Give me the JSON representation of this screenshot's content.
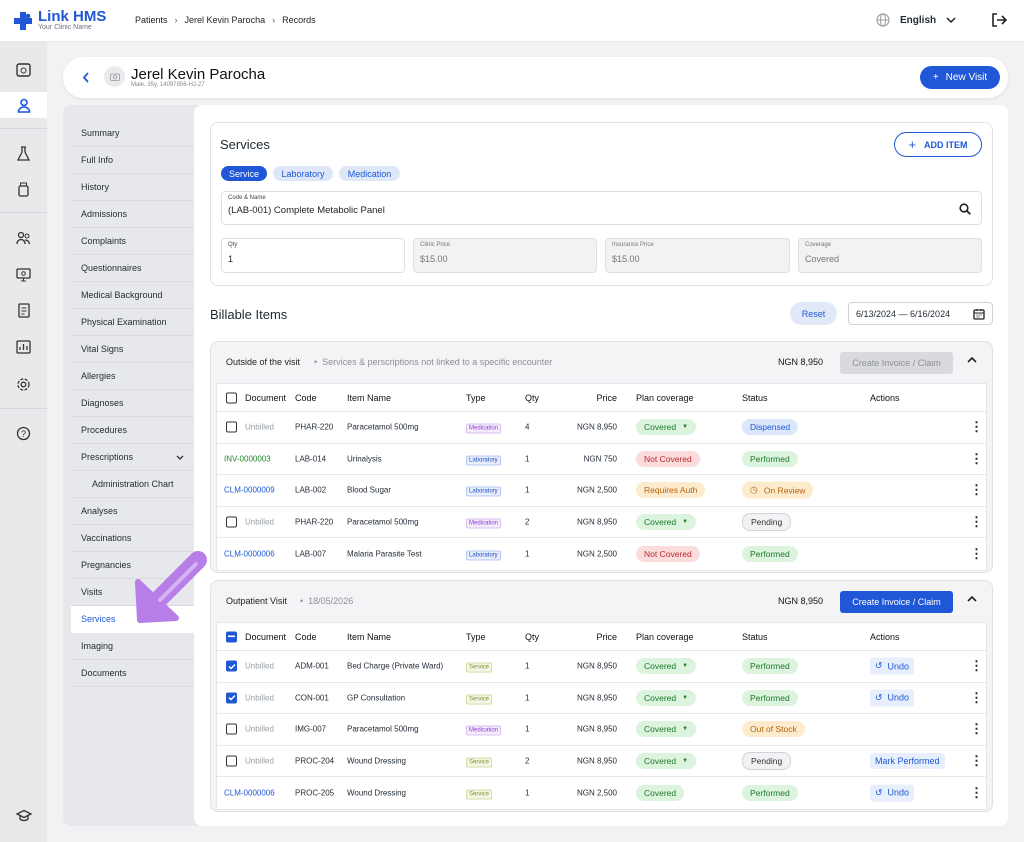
{
  "app": {
    "name": "Link HMS",
    "tagline": "Your Clinic Name"
  },
  "breadcrumb": [
    "Patients",
    "Jerel Kevin Parocha",
    "Records"
  ],
  "language": "English",
  "patient": {
    "name": "Jerel Kevin Parocha",
    "meta": "Male, 35y, 14097856-HJ-27"
  },
  "new_visit_label": "New Visit",
  "subnav": [
    {
      "label": "Summary"
    },
    {
      "label": "Full Info"
    },
    {
      "label": "History"
    },
    {
      "label": "Admissions"
    },
    {
      "label": "Complaints"
    },
    {
      "label": "Questionnaires"
    },
    {
      "label": "Medical Background"
    },
    {
      "label": "Physical Examination"
    },
    {
      "label": "Vital Signs"
    },
    {
      "label": "Allergies"
    },
    {
      "label": "Diagnoses"
    },
    {
      "label": "Procedures"
    },
    {
      "label": "Prescriptions"
    },
    {
      "label": "Administration Chart"
    },
    {
      "label": "Analyses"
    },
    {
      "label": "Vaccinations"
    },
    {
      "label": "Pregnancies"
    },
    {
      "label": "Visits"
    },
    {
      "label": "Services"
    },
    {
      "label": "Imaging"
    },
    {
      "label": "Documents"
    }
  ],
  "services": {
    "title": "Services",
    "add_item": "ADD ITEM",
    "chips": [
      "Service",
      "Laboratory",
      "Medication"
    ],
    "code_label": "Code & Name",
    "code_value": "(LAB-001) Complete Metabolic Panel",
    "qty_label": "Qty",
    "qty_value": "1",
    "clinic_label": "Clinic Price",
    "clinic_value": "$15.00",
    "ins_label": "Insurance Price",
    "ins_value": "$15.00",
    "cov_label": "Coverage",
    "cov_value": "Covered"
  },
  "billable": {
    "title": "Billable Items",
    "reset": "Reset",
    "date_range": "6/13/2024 — 6/16/2024"
  },
  "columns": [
    "Document",
    "Code",
    "Item Name",
    "Type",
    "Qty",
    "Price",
    "Plan coverage",
    "Status",
    "Actions"
  ],
  "group1": {
    "name": "Outside of the visit",
    "desc": "Services & perscriptions not linked to a specific encounter",
    "total": "NGN 8,950",
    "invoice_label": "Create Invoice / Claim",
    "rows": [
      {
        "doc": "Unbilled",
        "code": "PHAR-220",
        "name": "Paracetamol 500mg",
        "type": "Medication",
        "qty": "4",
        "price": "NGN 8,950",
        "coverage": "Covered",
        "status": "Dispensed"
      },
      {
        "doc": "INV-0000003",
        "code": "LAB-014",
        "name": "Urinalysis",
        "type": "Laboratory",
        "qty": "1",
        "price": "NGN 750",
        "coverage": "Not Covered",
        "status": "Performed"
      },
      {
        "doc": "CLM-0000009",
        "code": "LAB-002",
        "name": "Blood Sugar",
        "type": "Laboratory",
        "qty": "1",
        "price": "NGN 2,500",
        "coverage": "Requires Auth",
        "status": "On Review"
      },
      {
        "doc": "Unbilled",
        "code": "PHAR-220",
        "name": "Paracetamol 500mg",
        "type": "Medication",
        "qty": "2",
        "price": "NGN 8,950",
        "coverage": "Covered",
        "status": "Pending"
      },
      {
        "doc": "CLM-0000006",
        "code": "LAB-007",
        "name": "Malaria Parasite Test",
        "type": "Laboratory",
        "qty": "1",
        "price": "NGN 2,500",
        "coverage": "Not Covered",
        "status": "Performed"
      }
    ]
  },
  "group2": {
    "name": "Outpatient Visit",
    "date": "18/05/2026",
    "total": "NGN 8,950",
    "invoice_label": "Create Invoice / Claim",
    "rows": [
      {
        "doc": "Unbilled",
        "code": "ADM-001",
        "name": "Bed Charge (Private Ward)",
        "type": "Service",
        "qty": "1",
        "price": "NGN 8,950",
        "coverage": "Covered",
        "status": "Performed",
        "action": "Undo"
      },
      {
        "doc": "Unbilled",
        "code": "CON-001",
        "name": "GP Consultation",
        "type": "Service",
        "qty": "1",
        "price": "NGN 8,950",
        "coverage": "Covered",
        "status": "Performed",
        "action": "Undo"
      },
      {
        "doc": "Unbilled",
        "code": "IMG-007",
        "name": "Paracetamol 500mg",
        "type": "Medication",
        "qty": "1",
        "price": "NGN 8,950",
        "coverage": "Covered",
        "status": "Out of Stock",
        "action": ""
      },
      {
        "doc": "Unbilled",
        "code": "PROC-204",
        "name": "Wound Dressing",
        "type": "Service",
        "qty": "2",
        "price": "NGN 8,950",
        "coverage": "Covered",
        "status": "Pending",
        "action": "Mark Performed"
      },
      {
        "doc": "CLM-0000006",
        "code": "PROC-205",
        "name": "Wound Dressing",
        "type": "Service",
        "qty": "1",
        "price": "NGN 2,500",
        "coverage": "Covered",
        "status": "Performed",
        "action": "Undo"
      }
    ]
  },
  "colors": {
    "accent": "#1f57d6",
    "arrow": "#b77ee8"
  }
}
